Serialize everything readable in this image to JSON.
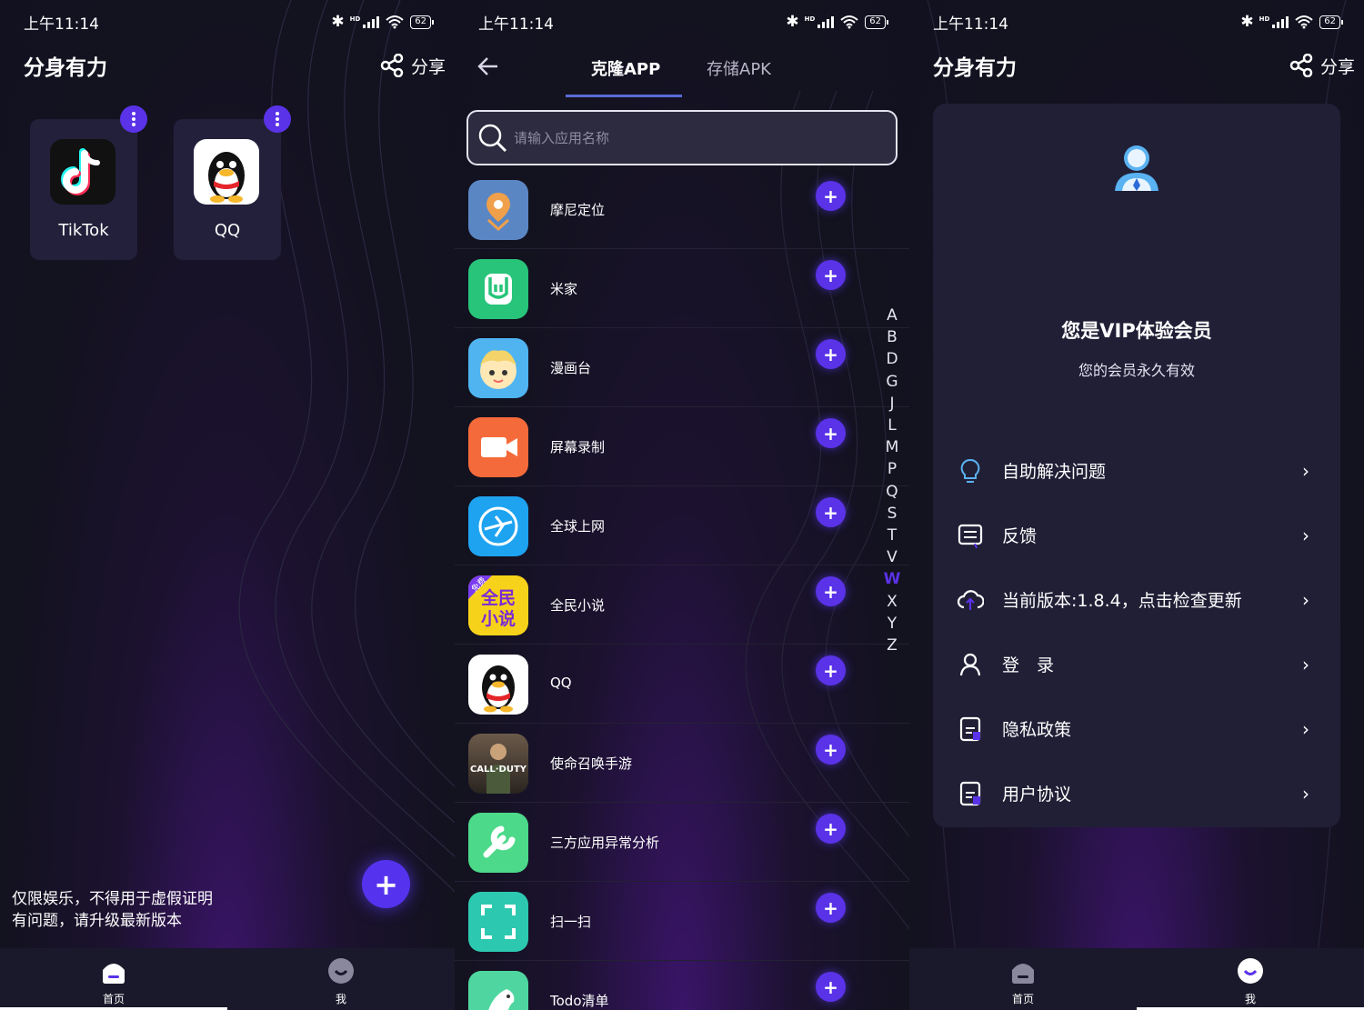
{
  "status": {
    "time": "上午11:14",
    "hd": "HD",
    "battery": "62"
  },
  "home": {
    "title": "分身有力",
    "share_label": "分享",
    "apps": [
      {
        "name": "TikTok"
      },
      {
        "name": "QQ"
      }
    ],
    "disclaimer": [
      "仅限娱乐，不得用于虚假证明",
      "有问题，请升级最新版本"
    ],
    "fab_label": "+"
  },
  "clone": {
    "tabs": [
      "克隆APP",
      "存储APK"
    ],
    "search_placeholder": "请输入应用名称",
    "apps": [
      {
        "name": "摩尼定位"
      },
      {
        "name": "米家"
      },
      {
        "name": "漫画台"
      },
      {
        "name": "屏幕录制"
      },
      {
        "name": "全球上网"
      },
      {
        "name": "全民小说",
        "icon_text": "全民\n小说",
        "badge": "免费"
      },
      {
        "name": "QQ"
      },
      {
        "name": "使命召唤手游",
        "icon_text": "CALL·DUTY"
      },
      {
        "name": "三方应用异常分析"
      },
      {
        "name": "扫一扫"
      },
      {
        "name": "Todo清单"
      }
    ],
    "index_letters": [
      "A",
      "B",
      "D",
      "G",
      "J",
      "L",
      "M",
      "P",
      "Q",
      "S",
      "T",
      "V",
      "W",
      "X",
      "Y",
      "Z"
    ],
    "index_active": "W",
    "add_label": "+"
  },
  "me": {
    "title": "分身有力",
    "share_label": "分享",
    "vip_title": "您是VIP体验会员",
    "vip_sub": "您的会员永久有效",
    "menu": [
      {
        "label": "自助解决问题",
        "icon": "lightbulb-icon"
      },
      {
        "label": "反馈",
        "icon": "feedback-icon"
      },
      {
        "label": "当前版本:1.8.4，点击检查更新",
        "icon": "cloud-update-icon"
      },
      {
        "label": "登　录",
        "icon": "user-icon"
      },
      {
        "label": "隐私政策",
        "icon": "document-icon"
      },
      {
        "label": "用户协议",
        "icon": "agreement-icon"
      }
    ]
  },
  "nav": {
    "home_label": "首页",
    "me_label": "我"
  },
  "colors": {
    "accent": "#5a32e8",
    "background": "#13121f",
    "card": "#22203a",
    "tab_underline": "#5a6bd6"
  }
}
